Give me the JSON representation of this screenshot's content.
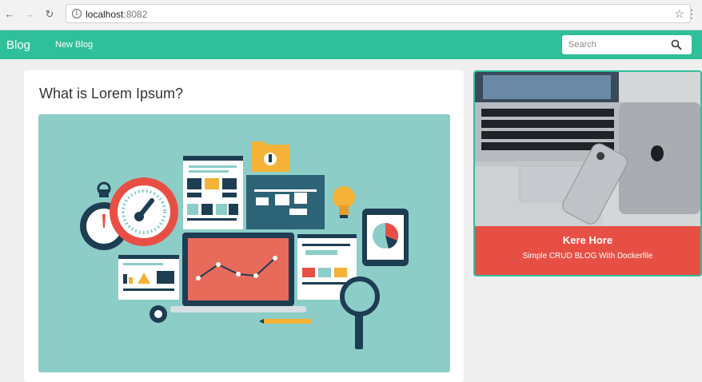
{
  "browser": {
    "url_host": "localhost",
    "url_port": ":8082",
    "back_icon": "arrow-left-icon",
    "forward_icon": "arrow-right-icon",
    "reload_icon": "reload-icon",
    "bookmark_icon": "star-icon",
    "menu_icon": "kebab-menu-icon"
  },
  "navbar": {
    "brand": "Blog",
    "links": [
      "New Blog"
    ],
    "search_placeholder": "Search",
    "accent_color": "#2fbf9a"
  },
  "post": {
    "title": "What is Lorem Ipsum?"
  },
  "featured": {
    "title": "Kere Hore",
    "subtitle": "Simple CRUD BLOG With Dockerfile",
    "footer_color": "#e84f44"
  }
}
